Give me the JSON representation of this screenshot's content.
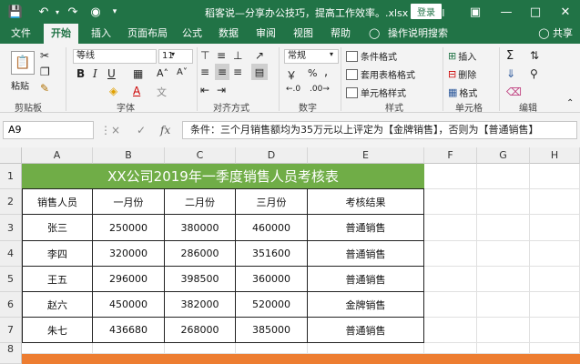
{
  "titlebar": {
    "title": "稻客说—分享办公技巧，提高工作效率。.xlsx - Excel",
    "login": "登录"
  },
  "tabs": [
    "文件",
    "开始",
    "插入",
    "页面布局",
    "公式",
    "数据",
    "审阅",
    "视图",
    "帮助"
  ],
  "tell_me": "操作说明搜索",
  "share": "共享",
  "ribbon": {
    "groups": [
      "剪贴板",
      "字体",
      "对齐方式",
      "数字",
      "样式",
      "单元格",
      "编辑"
    ],
    "paste_label": "粘贴",
    "font_name": "等线",
    "font_size": "11",
    "number_format": "常规",
    "styles": [
      "条件格式",
      "套用表格格式",
      "单元格样式"
    ],
    "cells": [
      "插入",
      "删除",
      "格式"
    ],
    "bold": "B",
    "italic": "I",
    "underline": "U"
  },
  "formula_bar": {
    "name_box": "A9",
    "cancel": "×",
    "enter": "✓",
    "fx": "fx",
    "formula": "条件：三个月销售额均为35万元以上评定为【金牌销售】，否则为【普通销售】"
  },
  "sheet": {
    "columns": [
      "A",
      "B",
      "C",
      "D",
      "E",
      "F",
      "G",
      "H"
    ],
    "rows": [
      "1",
      "2",
      "3",
      "4",
      "5",
      "6",
      "7",
      "8"
    ],
    "title": "XX公司2019年一季度销售人员考核表",
    "headers": [
      "销售人员",
      "一月份",
      "二月份",
      "三月份",
      "考核结果"
    ],
    "data": [
      [
        "张三",
        "250000",
        "380000",
        "460000",
        "普通销售"
      ],
      [
        "李四",
        "320000",
        "286000",
        "351600",
        "普通销售"
      ],
      [
        "王五",
        "296000",
        "398500",
        "360000",
        "普通销售"
      ],
      [
        "赵六",
        "450000",
        "382000",
        "520000",
        "金牌销售"
      ],
      [
        "朱七",
        "436680",
        "268000",
        "385000",
        "普通销售"
      ]
    ]
  },
  "colors": {
    "excel_green": "#217346",
    "title_fill": "#70ad47",
    "orange_fill": "#ed7d31"
  }
}
